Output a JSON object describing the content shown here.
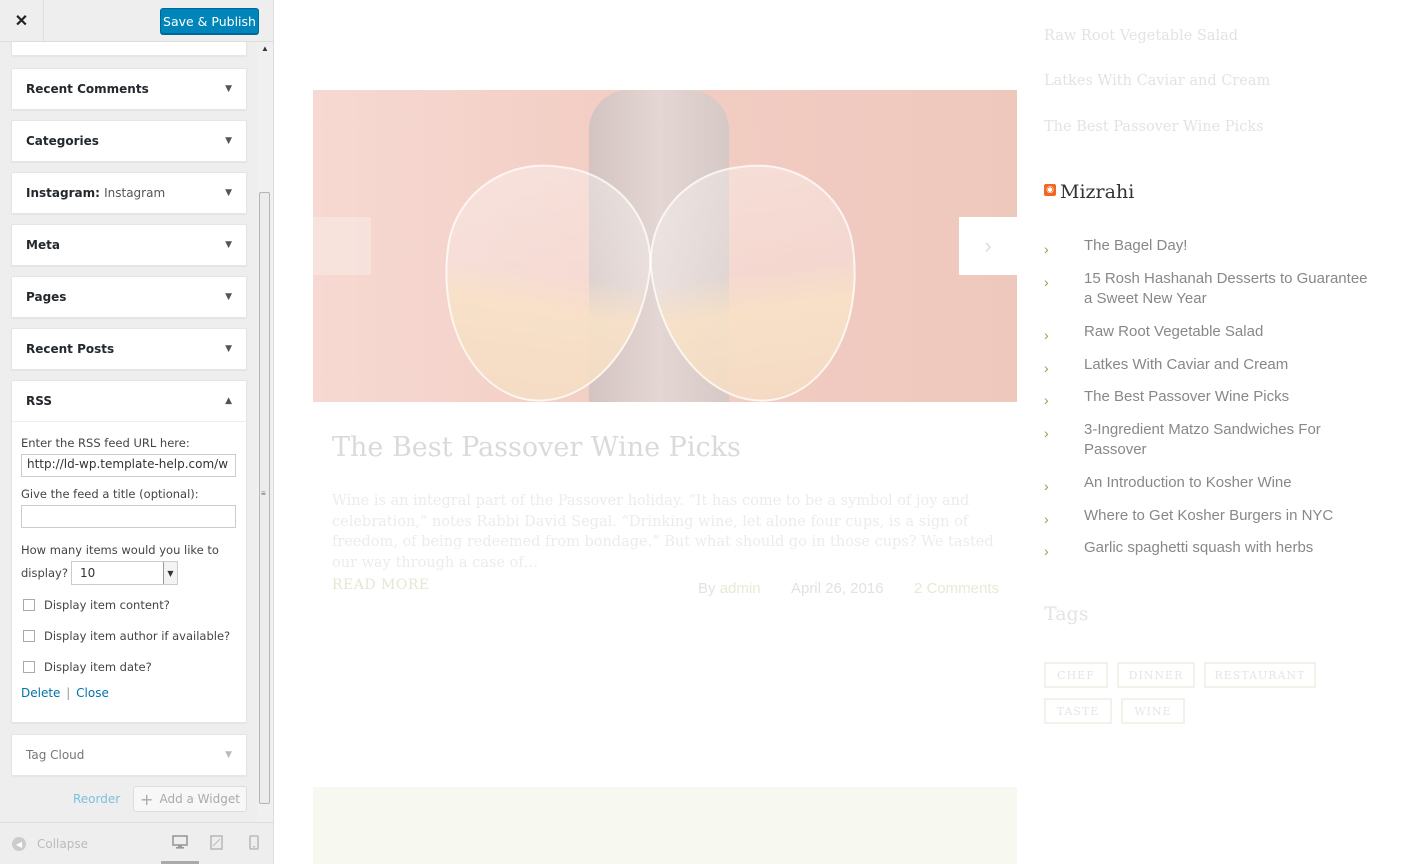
{
  "header": {
    "close_glyph": "✕",
    "save_label": "Save & Publish"
  },
  "widgets": [
    {
      "title": "Recent Comments",
      "sub": ""
    },
    {
      "title": "Categories",
      "sub": ""
    },
    {
      "title": "Instagram:",
      "sub": "Instagram"
    },
    {
      "title": "Meta",
      "sub": ""
    },
    {
      "title": "Pages",
      "sub": ""
    },
    {
      "title": "Recent Posts",
      "sub": ""
    },
    {
      "title": "RSS",
      "sub": ""
    },
    {
      "title": "Tag Cloud",
      "sub": ""
    }
  ],
  "rss_form": {
    "url_label": "Enter the RSS feed URL here:",
    "url_value": "http://ld-wp.template-help.com/w",
    "title_label": "Give the feed a title (optional):",
    "title_value": "",
    "items_label_1": "How many items would you like to",
    "items_label_2": "display?",
    "items_value": "10",
    "opt_content": "Display item content?",
    "opt_author": "Display item author if available?",
    "opt_date": "Display item date?",
    "delete_label": "Delete",
    "separator": "|",
    "close_label": "Close"
  },
  "footer_actions": {
    "reorder_label": "Reorder",
    "add_widget_label": "Add a Widget"
  },
  "footer": {
    "collapse_label": "Collapse"
  },
  "preview": {
    "post_title": "The Best Passover Wine Picks",
    "post_excerpt": "Wine is an integral part of the Passover holiday. “It has come to be a symbol of joy and celebration,” notes Rabbi David Segal. “Drinking wine, let alone four cups, is a sign of freedom, of being redeemed from bondage.” But what should go in those cups? We tasted our way through a case of…",
    "read_more": "READ MORE",
    "meta_by": "By",
    "meta_author": "admin",
    "meta_date": "April 26, 2016",
    "meta_comments": "2 Comments",
    "recent_top": [
      "Raw Root Vegetable Salad",
      "Latkes With Caviar and Cream",
      "The Best Passover Wine Picks"
    ],
    "rss_title": "Mizrahi",
    "rss_items": [
      "The Bagel Day!",
      "15 Rosh Hashanah Desserts to Guarantee a Sweet New Year",
      "Raw Root Vegetable Salad",
      "Latkes With Caviar and Cream",
      "The Best Passover Wine Picks",
      "3-Ingredient Matzo Sandwiches For Passover",
      "An Introduction to Kosher Wine",
      "Where to Get Kosher Burgers in NYC",
      "Garlic spaghetti squash with herbs"
    ],
    "tags_title": "Tags",
    "tags": [
      "CHEF",
      "DINNER",
      "RESTAURANT",
      "TASTE",
      "WINE"
    ]
  },
  "colors": {
    "save_button": "#0085ba",
    "link": "#0073aa",
    "bullet_green": "#8ba43a",
    "rss_orange": "#f26522"
  },
  "icons": [
    "close-icon",
    "dropdown-arrow-icon",
    "collapse-icon",
    "desktop-icon",
    "tablet-icon",
    "mobile-icon",
    "rss-feed-icon",
    "plus-icon",
    "chevron-left-icon",
    "chevron-right-icon"
  ]
}
